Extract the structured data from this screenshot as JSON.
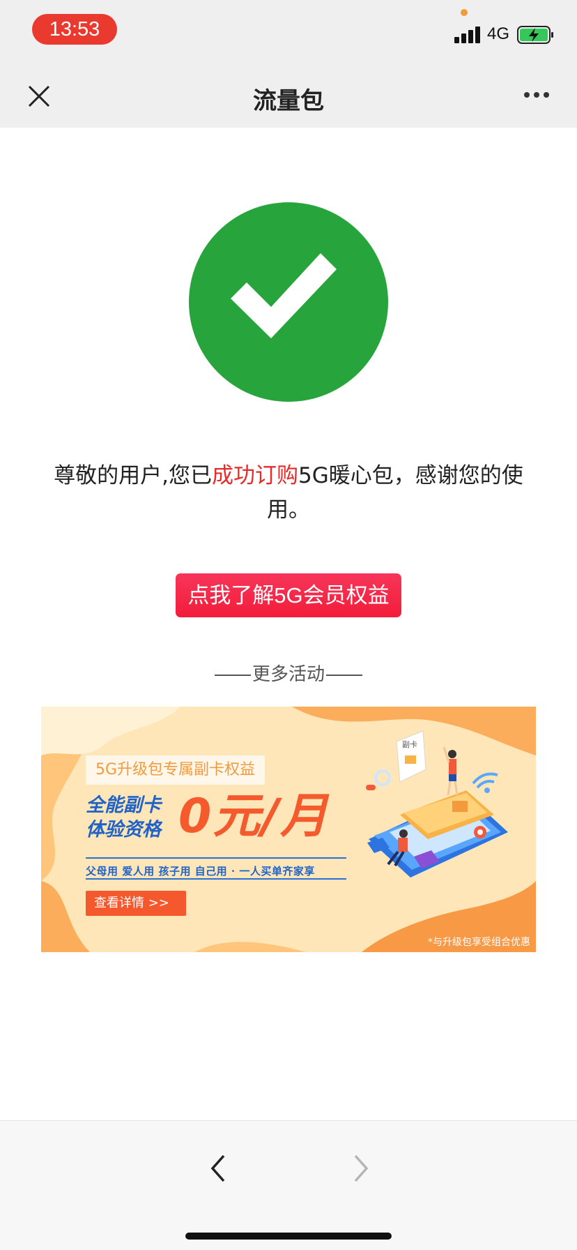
{
  "status_bar": {
    "time": "13:53",
    "network": "4G",
    "icons": [
      "signal-bars-icon",
      "battery-charging-icon"
    ],
    "colors": {
      "time_pill": "#ea3a2f",
      "battery_fill": "#35c759"
    }
  },
  "nav_bar": {
    "title": "流量包",
    "close_icon": "close-icon",
    "more_icon": "more-dots-icon"
  },
  "success": {
    "icon": "check-circle-icon",
    "color": "#27a53c",
    "message_prefix": "尊敬的用户,您已",
    "message_highlight": "成功订购",
    "message_suffix": "5G暖心包，感谢您的使用。"
  },
  "cta_button": {
    "label": "点我了解5G会员权益",
    "color": "#f42944"
  },
  "more_section": {
    "title": "更多活动"
  },
  "banner": {
    "tag": "5G升级包专属副卡权益",
    "headline_line1": "全能副卡",
    "headline_line2": "体验资格",
    "price": "0元/月",
    "uses": "父母用  爱人用  孩子用  自己用 · 一人买单齐家享",
    "button_label": "查看详情 >>",
    "note": "*与升级包享受组合优惠",
    "card_label": "副卡"
  },
  "bottom_bar": {
    "back_icon": "chevron-left-icon",
    "forward_icon": "chevron-right-icon"
  }
}
